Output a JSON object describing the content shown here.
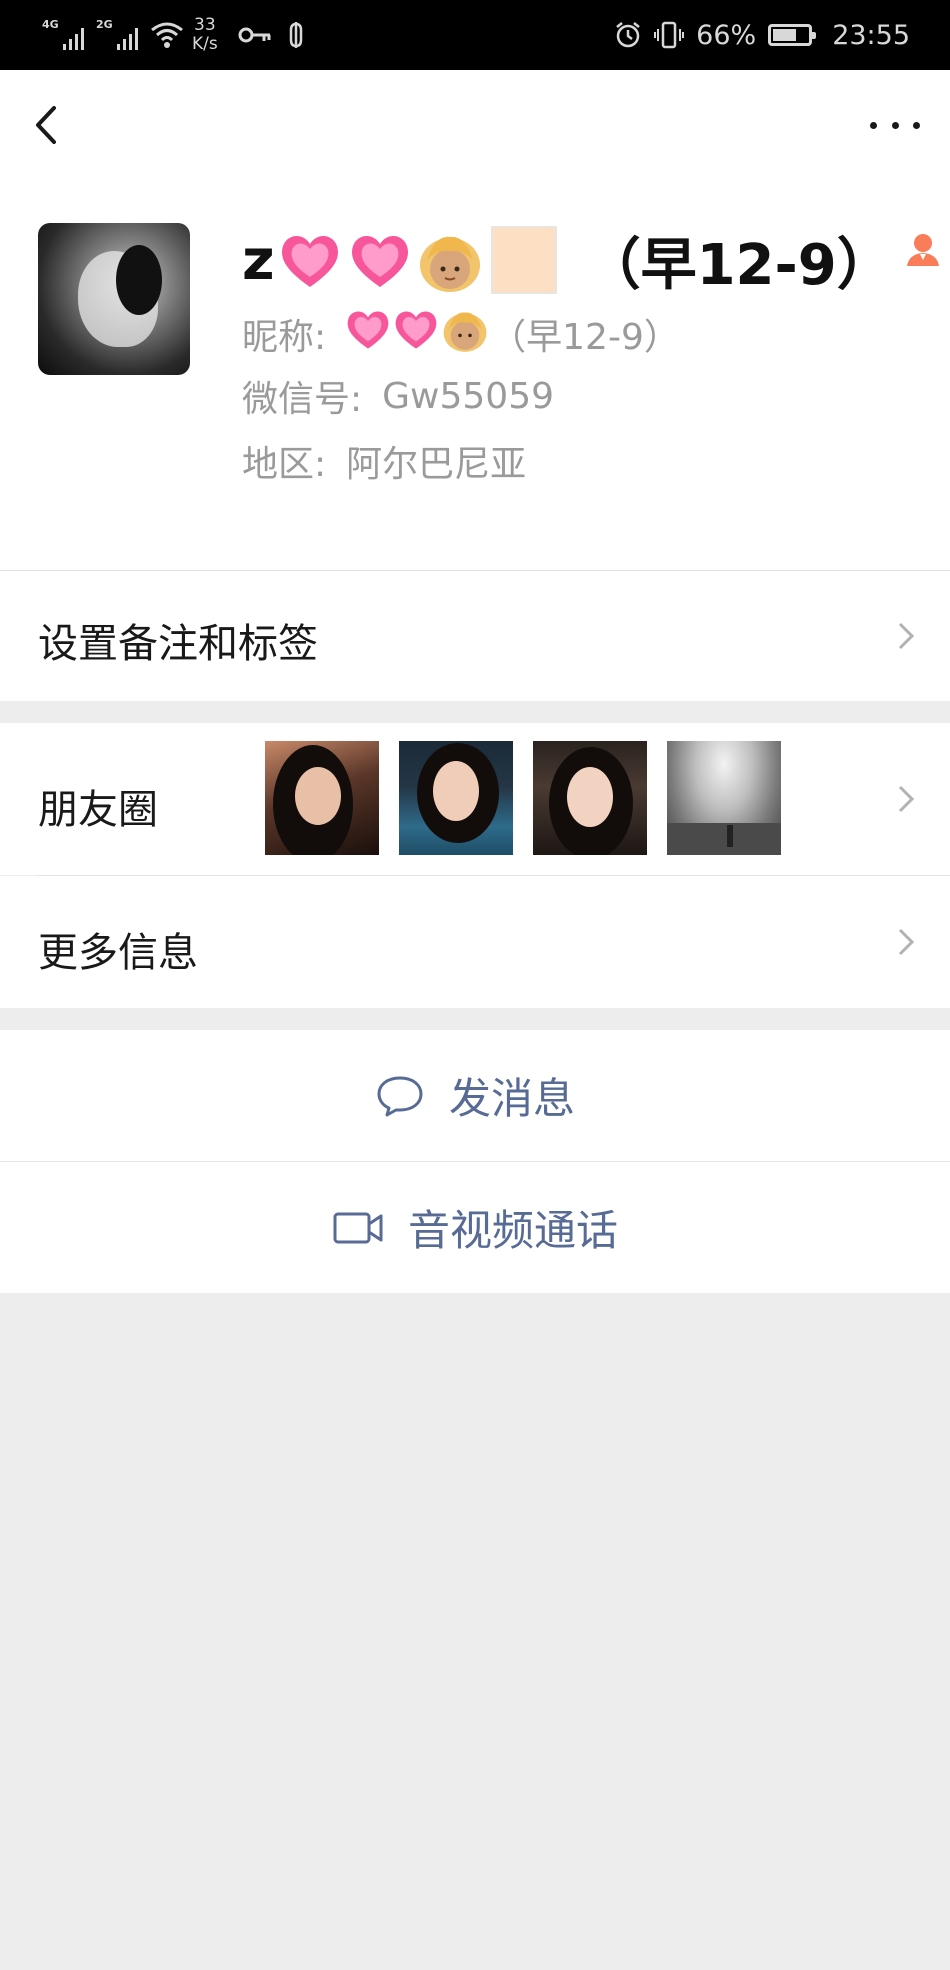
{
  "status_bar": {
    "signal1_tag": "4G",
    "signal2_tag": "2G",
    "net_speed_value": "33",
    "net_speed_unit": "K/s",
    "battery_percent": "66%",
    "battery_level": 0.66,
    "time": "23:55"
  },
  "profile": {
    "display_name_suffix": "（早12-9）",
    "name_prefix": "z",
    "nickname_label": "昵称:",
    "nickname_suffix": "（早12-9）",
    "wechat_id_label": "微信号:",
    "wechat_id": "Gw55059",
    "region_label": "地区:",
    "region": "阿尔巴尼亚"
  },
  "cells": {
    "remark_tags": "设置备注和标签",
    "moments": "朋友圈",
    "more_info": "更多信息"
  },
  "actions": {
    "send_message": "发消息",
    "av_call": "音视频通话"
  },
  "colors": {
    "accent_blue": "#576b95",
    "badge_orange": "#fa7d5a"
  },
  "icons": [
    "back-arrow-icon",
    "more-dots-icon",
    "heart-emoji-icon",
    "girl-emoji-icon",
    "profile-badge-icon",
    "chevron-right-icon",
    "chat-bubble-icon",
    "video-call-icon"
  ]
}
